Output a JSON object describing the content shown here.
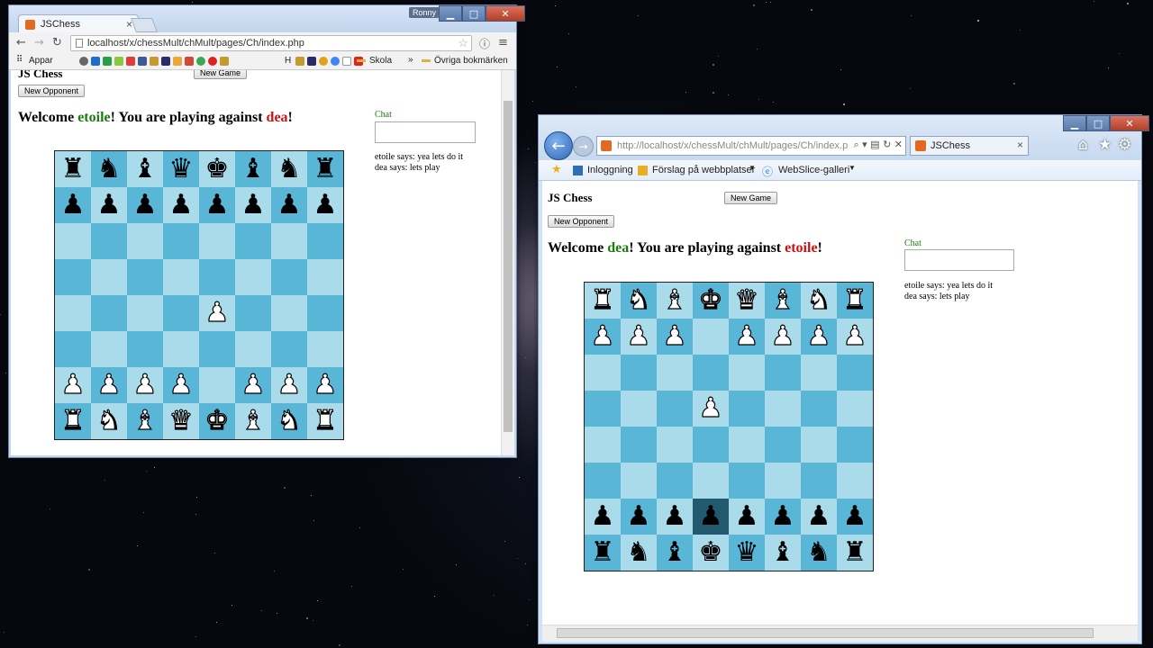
{
  "chrome": {
    "tab_title": "JSChess",
    "tab_close": "×",
    "user": "Ronny",
    "url": "localhost/x/chessMult/chMult/pages/Ch/index.php",
    "bookmarks": {
      "apps": "Appar",
      "h": "H",
      "skola": "Skola",
      "more": "»",
      "other": "Övriga bokmärken"
    },
    "page": {
      "title": "JS Chess",
      "new_game": "New Game",
      "new_opponent": "New Opponent",
      "welcome": "Welcome ",
      "me": "etoile",
      "mid": "! You are playing against ",
      "opp": "dea",
      "end": "!",
      "chat_label": "Chat",
      "chat_log": [
        "etoile says: yea lets do it",
        "dea says: lets play"
      ]
    },
    "board": [
      [
        "bR",
        "bN",
        "bB",
        "bQ",
        "bK",
        "bB",
        "bN",
        "bR"
      ],
      [
        "bP",
        "bP",
        "bP",
        "bP",
        "bP",
        "bP",
        "bP",
        "bP"
      ],
      [
        "",
        "",
        "",
        "",
        "",
        "",
        "",
        ""
      ],
      [
        "",
        "",
        "",
        "",
        "",
        "",
        "",
        ""
      ],
      [
        "",
        "",
        "",
        "",
        "wP",
        "",
        "",
        ""
      ],
      [
        "",
        "",
        "",
        "",
        "",
        "",
        "",
        ""
      ],
      [
        "wP",
        "wP",
        "wP",
        "wP",
        "",
        "wP",
        "wP",
        "wP"
      ],
      [
        "wR",
        "wN",
        "wB",
        "wQ",
        "wK",
        "wB",
        "wN",
        "wR"
      ]
    ]
  },
  "ie": {
    "url": "http://localhost/x/chessMult/chMult/pages/Ch/index.p",
    "tab_title": "JSChess",
    "tab_close": "×",
    "favorites": {
      "inlogg": "Inloggning",
      "forslag": "Förslag på webbplatser",
      "webslice": "WebSlice-galleri"
    },
    "page": {
      "title": "JS Chess",
      "new_game": "New Game",
      "new_opponent": "New Opponent",
      "welcome": "Welcome ",
      "me": "dea",
      "mid": "! You are playing against ",
      "opp": "etoile",
      "end": "!",
      "chat_label": "Chat",
      "chat_log": [
        "etoile says: yea lets do it",
        "dea says: lets play"
      ]
    },
    "board": [
      [
        "wR",
        "wN",
        "wB",
        "wK",
        "wQ",
        "wB",
        "wN",
        "wR"
      ],
      [
        "wP",
        "wP",
        "wP",
        "",
        "wP",
        "wP",
        "wP",
        "wP"
      ],
      [
        "",
        "",
        "",
        "",
        "",
        "",
        "",
        ""
      ],
      [
        "",
        "",
        "",
        "wP",
        "",
        "",
        "",
        ""
      ],
      [
        "",
        "",
        "",
        "",
        "",
        "",
        "",
        ""
      ],
      [
        "",
        "",
        "",
        "",
        "",
        "",
        "",
        ""
      ],
      [
        "bP",
        "bP",
        "bP",
        "bP",
        "bP",
        "bP",
        "bP",
        "bP"
      ],
      [
        "bR",
        "bN",
        "bB",
        "bK",
        "bQ",
        "bB",
        "bN",
        "bR"
      ]
    ],
    "highlight": [
      6,
      3
    ]
  },
  "pieces": {
    "K": "♚",
    "Q": "♛",
    "R": "♜",
    "B": "♝",
    "N": "♞",
    "P": "♟"
  },
  "colors": {
    "me": "#1e7a12",
    "opponent": "#cc1111",
    "light_square": "#a9dbeb",
    "dark_square": "#5ab6d6",
    "highlight_square": "#21596e"
  }
}
